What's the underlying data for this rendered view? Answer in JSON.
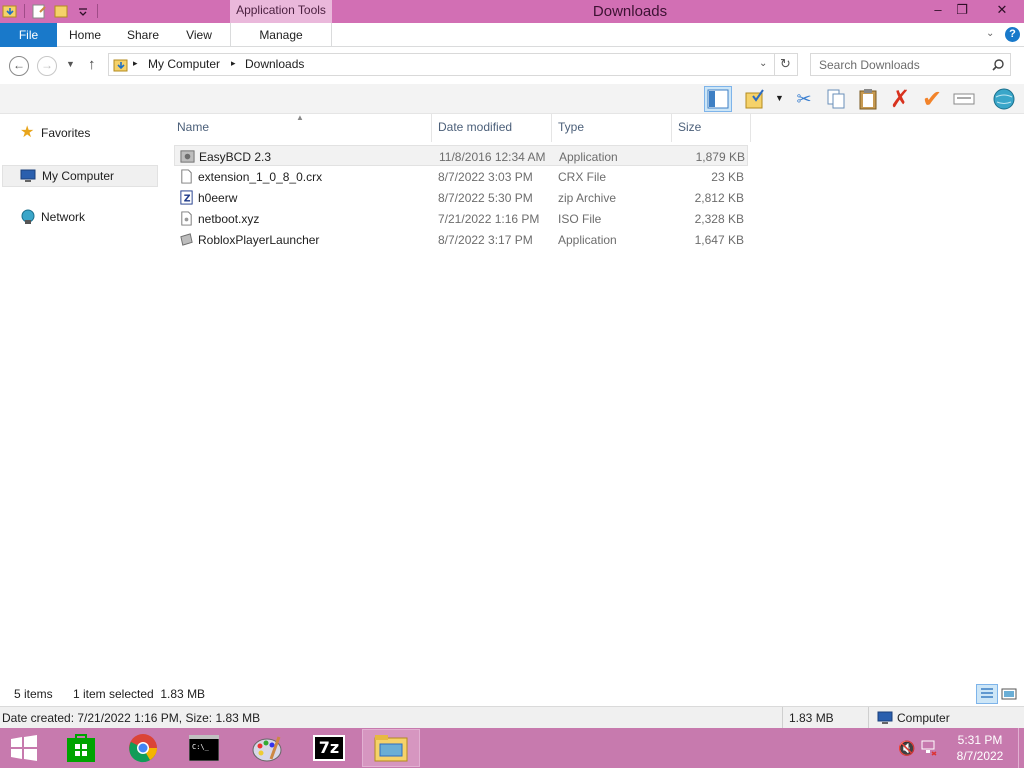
{
  "window": {
    "title": "Downloads",
    "context_tab": "Application Tools",
    "controls": {
      "minimize": "–",
      "maximize": "❐",
      "close": "✕"
    }
  },
  "ribbon": {
    "tabs": [
      {
        "label": "File"
      },
      {
        "label": "Home"
      },
      {
        "label": "Share"
      },
      {
        "label": "View"
      },
      {
        "label": "Manage"
      }
    ],
    "help": "?"
  },
  "address": {
    "breadcrumb": [
      "My Computer",
      "Downloads"
    ],
    "search_placeholder": "Search Downloads"
  },
  "navigation": {
    "items": [
      {
        "label": "Favorites"
      },
      {
        "label": "My Computer"
      },
      {
        "label": "Network"
      }
    ]
  },
  "file_list": {
    "columns": [
      "Name",
      "Date modified",
      "Type",
      "Size"
    ],
    "rows": [
      {
        "name": "EasyBCD 2.3",
        "date": "11/8/2016 12:34 AM",
        "type": "Application",
        "size": "1,879 KB",
        "selected": true
      },
      {
        "name": "extension_1_0_8_0.crx",
        "date": "8/7/2022 3:03 PM",
        "type": "CRX File",
        "size": "23 KB"
      },
      {
        "name": "h0eerw",
        "date": "8/7/2022 5:30 PM",
        "type": "zip Archive",
        "size": "2,812 KB"
      },
      {
        "name": "netboot.xyz",
        "date": "7/21/2022 1:16 PM",
        "type": "ISO File",
        "size": "2,328 KB"
      },
      {
        "name": "RobloxPlayerLauncher",
        "date": "8/7/2022 3:17 PM",
        "type": "Application",
        "size": "1,647 KB"
      }
    ]
  },
  "status": {
    "item_count": "5 items",
    "selection": "1 item selected  1.83 MB",
    "details": "Date created: 7/21/2022 1:16 PM, Size: 1.83 MB",
    "size": "1.83 MB",
    "location": "Computer"
  },
  "taskbar": {
    "apps": [
      "start",
      "store",
      "chrome",
      "cmd",
      "paint",
      "7zip",
      "file-explorer"
    ],
    "time": "5:31 PM",
    "date": "8/7/2022",
    "seven_zip_label": "7z"
  },
  "colors": {
    "titlebar": "#d26fb4",
    "file_tab": "#1979ca",
    "taskbar": "#c77aae"
  }
}
